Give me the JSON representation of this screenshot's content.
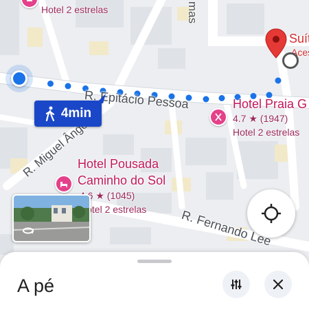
{
  "map": {
    "streets": [
      {
        "name": "R. Epitácio Pessoa"
      },
      {
        "name": "R. Miguel Ângelo"
      },
      {
        "name": "R. Fernando Lee"
      },
      {
        "name": "mas"
      }
    ],
    "places": [
      {
        "name": "Hotel Praia G",
        "rating": "4.7 ★ (1947)",
        "category": "Hotel 2 estrelas",
        "icon": "restaurant-icon"
      },
      {
        "name_line1": "Hotel Pousada",
        "name_line2": "Caminho do Sol",
        "rating": "4.6 ★ (1045)",
        "category": "Hotel 2 estrelas",
        "icon": "bed-icon"
      },
      {
        "name": "Hotel 2 estrelas",
        "icon": "hotel-icon"
      }
    ],
    "destination": {
      "name": "Suít",
      "subtitle": "Aces"
    },
    "route": {
      "mode_icon": "walking-icon",
      "duration": "4min",
      "color": "#1a73e8"
    }
  },
  "bottom_sheet": {
    "title": "A pé",
    "options_icon": "tune-icon",
    "close_icon": "close-icon"
  },
  "controls": {
    "recenter_icon": "crosshair-icon",
    "street_view_icon": "rotate-360-icon"
  },
  "colors": {
    "route_blue": "#1a73e8",
    "chip_blue": "#1a47c8",
    "poi_pink": "#e5408a",
    "destination_red": "#e53935"
  }
}
